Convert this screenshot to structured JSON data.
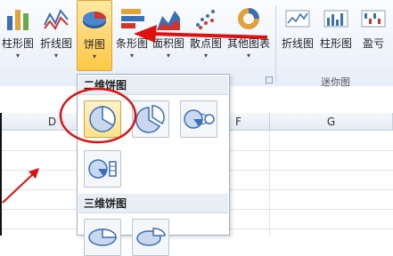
{
  "ribbon": {
    "buttons": [
      {
        "label": "柱形图",
        "icon": "column-chart-icon"
      },
      {
        "label": "折线图",
        "icon": "line-chart-icon"
      },
      {
        "label": "饼图",
        "icon": "pie-chart-icon"
      },
      {
        "label": "条形图",
        "icon": "bar-chart-icon"
      },
      {
        "label": "面积图",
        "icon": "area-chart-icon"
      },
      {
        "label": "散点图",
        "icon": "scatter-chart-icon"
      },
      {
        "label": "其他图表",
        "icon": "other-charts-icon"
      }
    ],
    "dropdown_arrow": "▾",
    "sparklines": {
      "group_label": "迷你图",
      "buttons": [
        {
          "label": "折线图",
          "icon": "sparkline-line-icon"
        },
        {
          "label": "柱形图",
          "icon": "sparkline-column-icon"
        },
        {
          "label": "盈亏",
          "icon": "sparkline-winloss-icon"
        }
      ]
    }
  },
  "sheet": {
    "columns": [
      "D",
      "F",
      "G"
    ]
  },
  "pie_menu": {
    "section_2d": "二维饼图",
    "section_3d": "三维饼图",
    "options_2d": [
      "pie",
      "exploded-pie",
      "pie-of-pie",
      "bar-of-pie"
    ],
    "options_3d": [
      "3d-pie",
      "exploded-3d-pie"
    ]
  },
  "colors": {
    "accent": "#ffc845",
    "annotation_red": "#e01010",
    "chart_blue": "#3b6fb6"
  }
}
